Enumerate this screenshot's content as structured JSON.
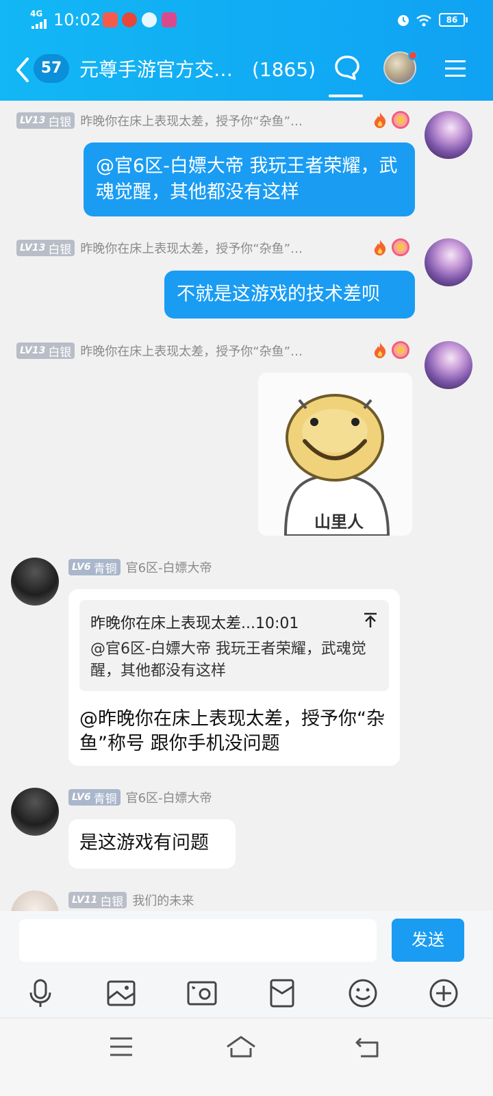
{
  "status_bar": {
    "network": "4G",
    "time": "10:02",
    "battery": "86"
  },
  "header": {
    "unread_count": "57",
    "chat_title": "元尊手游官方交…",
    "member_count": "(1865)"
  },
  "messages": [
    {
      "side": "right",
      "badge_lv": "LV13",
      "badge_rank": "白银",
      "sender": "昨晚你在床上表现太差，授予你“杂鱼”…",
      "text": "@官6区-白嫖大帝 我玩王者荣耀，武魂觉醒，其他都没有这样"
    },
    {
      "side": "right",
      "badge_lv": "LV13",
      "badge_rank": "白银",
      "sender": "昨晚你在床上表现太差，授予你“杂鱼”…",
      "text": "不就是这游戏的技术差呗"
    },
    {
      "side": "right",
      "badge_lv": "LV13",
      "badge_rank": "白银",
      "sender": "昨晚你在床上表现太差，授予你“杂鱼”…",
      "sticker_caption": "山里人"
    },
    {
      "side": "left",
      "badge_lv": "LV6",
      "badge_rank": "青铜",
      "sender": "官6区-白嫖大帝",
      "quote_head": "昨晚你在床上表现太差...10:01",
      "quote_body": "@官6区-白嫖大帝 我玩王者荣耀，武魂觉醒，其他都没有这样",
      "text": "@昨晚你在床上表现太差，授予你“杂鱼”称号 跟你手机没问题"
    },
    {
      "side": "left",
      "badge_lv": "LV6",
      "badge_rank": "青铜",
      "sender": "官6区-白嫖大帝",
      "text": "是这游戏有问题"
    },
    {
      "side": "left",
      "badge_lv": "LV11",
      "badge_rank": "白银",
      "sender": "我们的未来"
    }
  ],
  "composer": {
    "send_label": "发送"
  },
  "toolbar_icons": [
    "microphone-icon",
    "image-icon",
    "camera-icon",
    "red-packet-icon",
    "emoji-icon",
    "plus-icon"
  ],
  "colors": {
    "header_blue": "#12b7f5",
    "bubble_blue": "#1a9cf3",
    "background": "#f1f1f1"
  }
}
